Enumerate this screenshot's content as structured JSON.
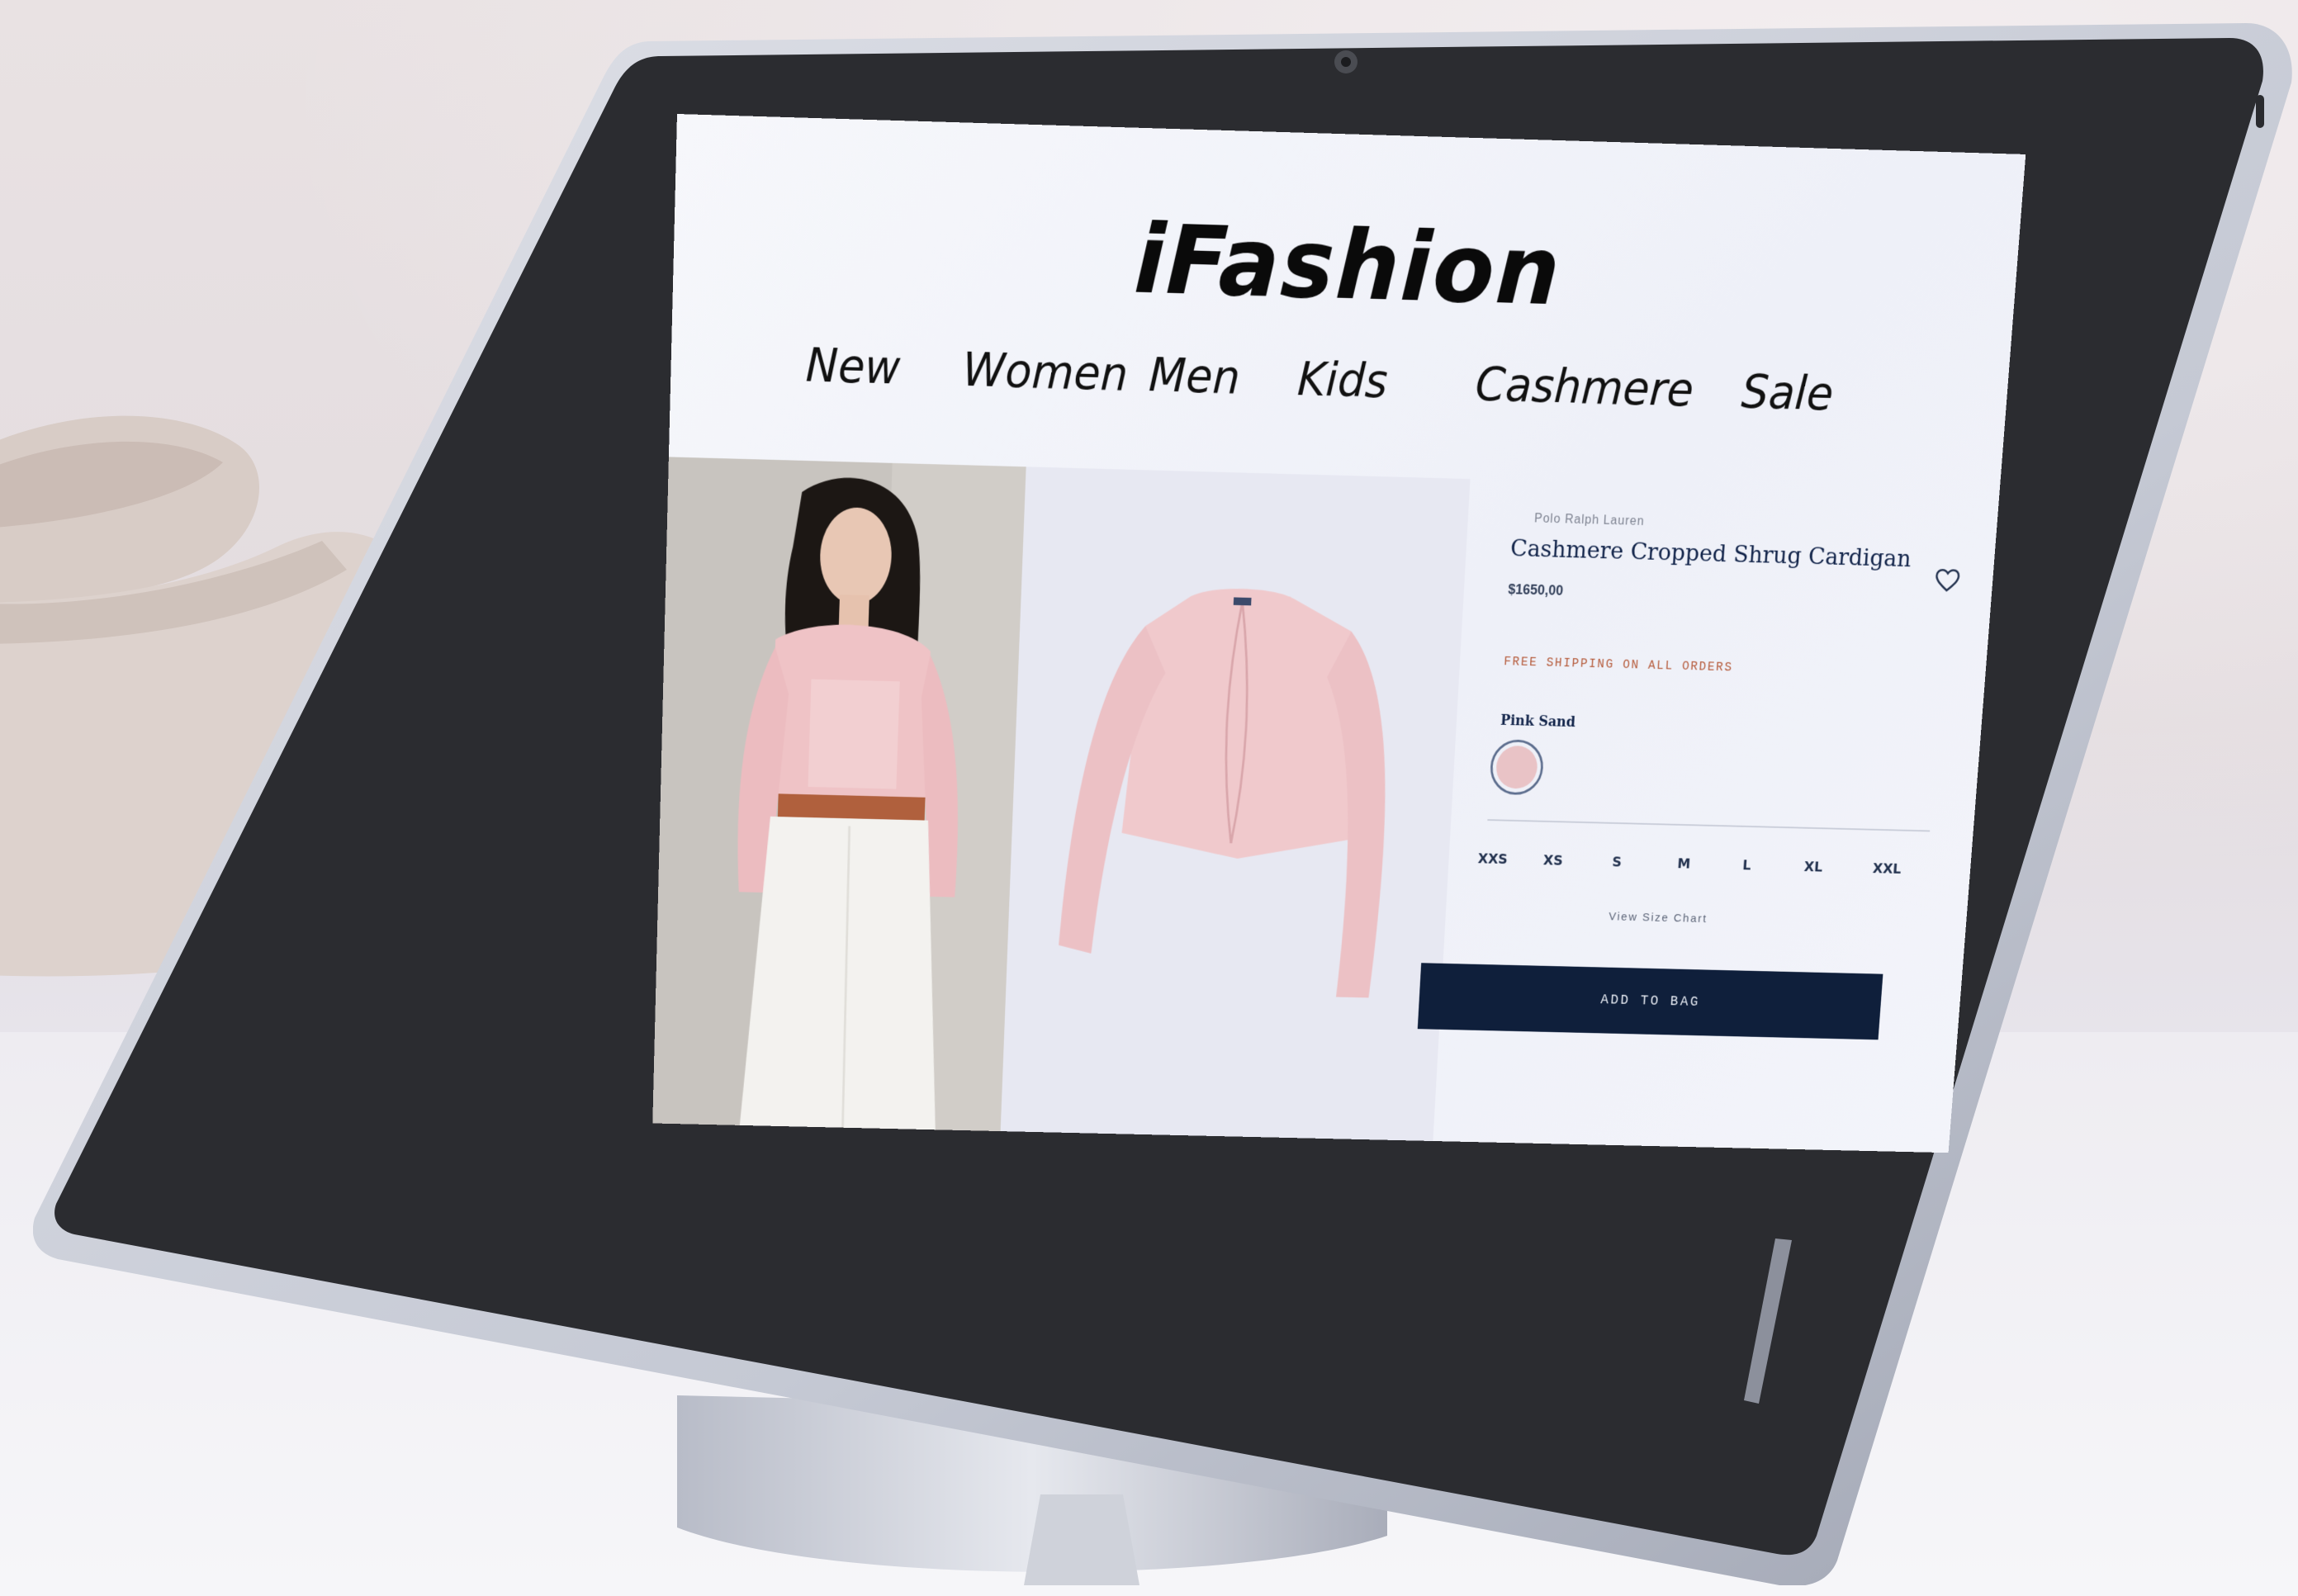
{
  "store": {
    "brand_name": "iFashion"
  },
  "nav": {
    "items": [
      "New",
      "Women",
      "Men",
      "Kids",
      "Cashmere",
      "Sale"
    ]
  },
  "product": {
    "brand": "Polo Ralph Lauren",
    "title": "Cashmere Cropped Shrug Cardigan",
    "price": "$1650,00",
    "shipping_note": "FREE SHIPPING ON ALL ORDERS",
    "color_label": "Pink Sand",
    "swatch_color": "#e9c3c6",
    "sizes": [
      "XXS",
      "XS",
      "S",
      "M",
      "L",
      "XL",
      "XXL"
    ],
    "size_chart_link": "View Size Chart",
    "add_to_bag_label": "ADD TO BAG"
  },
  "icons": {
    "wishlist": "heart-icon",
    "camera": "camera-icon"
  },
  "colors": {
    "accent_navy": "#0f1f3b",
    "shipping_text": "#b55a3a",
    "product_pink": "#f0c9cc"
  }
}
